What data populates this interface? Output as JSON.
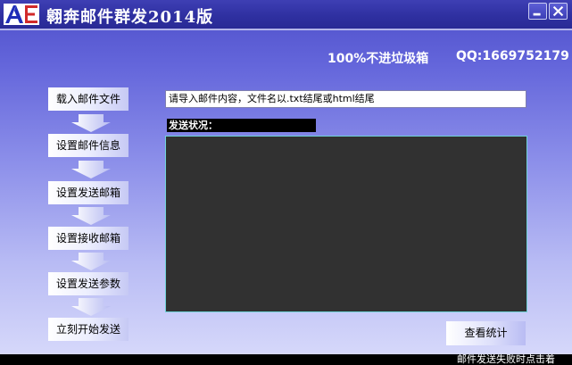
{
  "window": {
    "title": "翱奔邮件群发2014版",
    "logo_letters": "AE"
  },
  "header": {
    "slogan": "100%不进垃圾箱",
    "qq": "QQ:1669752179"
  },
  "steps": [
    {
      "label": "载入邮件文件"
    },
    {
      "label": "设置邮件信息"
    },
    {
      "label": "设置发送邮箱"
    },
    {
      "label": "设置接收邮箱"
    },
    {
      "label": "设置发送参数"
    },
    {
      "label": "立刻开始发送"
    }
  ],
  "content": {
    "input_value": "请导入邮件内容，文件名以.txt结尾或html结尾",
    "status_label": "发送状况：",
    "log_text": ""
  },
  "stats_button": {
    "label": "查看统计"
  },
  "statusbar": {
    "text": "邮件发送失败时点击着"
  },
  "colors": {
    "title_bar": "#2f30a1",
    "log_background": "#313131",
    "accent": "#6466db"
  },
  "icons": {
    "minimize": "minimize-icon",
    "close": "close-icon",
    "arrow": "down-arrow-icon"
  }
}
